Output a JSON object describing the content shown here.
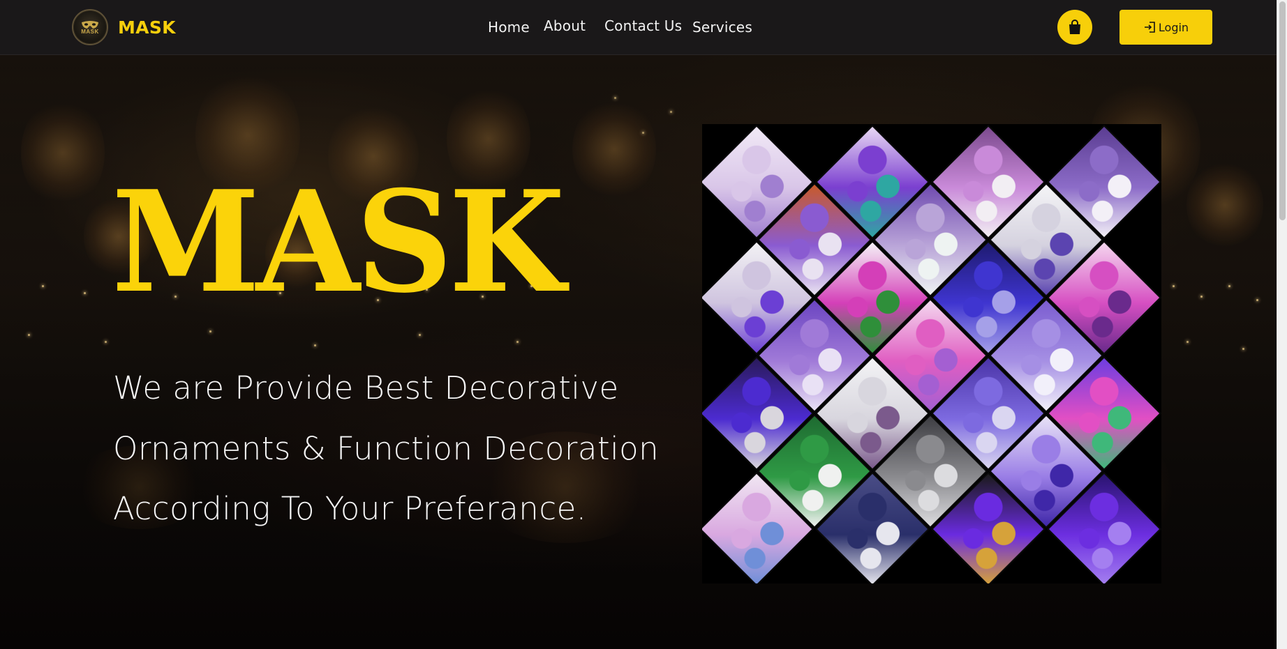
{
  "brand": {
    "name": "MASK",
    "logo_text": "MASK",
    "accent_color": "#f7cf0a"
  },
  "nav": {
    "home": "Home",
    "about": "About",
    "contact": "Contact Us",
    "services": "Services"
  },
  "actions": {
    "cart_icon": "shopping-bag-icon",
    "login_icon": "login-arrow-icon",
    "login_label": "Login"
  },
  "hero": {
    "title": "MASK",
    "lines": [
      "We are Provide Best Decorative",
      "Ornaments & Function Decoration",
      "According To Your Preferance."
    ],
    "background": "event-venue-photo"
  },
  "collage": {
    "image": "decoration-collage",
    "tiles": [
      {
        "name": "lavender-paper-flowers",
        "colors": [
          "#d9c6e8",
          "#a07fd0",
          "#f1e9f6"
        ]
      },
      {
        "name": "flower-vase-teal",
        "colors": [
          "#7b3fd0",
          "#2ea7a2",
          "#e8d8f4"
        ]
      },
      {
        "name": "pink-drape-backdrop",
        "colors": [
          "#c98ad9",
          "#f2eef3",
          "#7c4a8e"
        ]
      },
      {
        "name": "purple-flower-sign",
        "colors": [
          "#8c6cc8",
          "#f3f0f7",
          "#5b3d92"
        ]
      },
      {
        "name": "beaded-pot",
        "colors": [
          "#8a5bd1",
          "#e9e2f1",
          "#c85a2a"
        ]
      },
      {
        "name": "flower-arch-backdrop",
        "colors": [
          "#b9a4d8",
          "#eef3f2",
          "#6f4ab0"
        ]
      },
      {
        "name": "curtain-flowers",
        "colors": [
          "#d5d2df",
          "#5b44b0",
          "#f4f4f6"
        ]
      },
      {
        "name": "purple-curtain",
        "colors": [
          "#cfc4df",
          "#6b3fd4",
          "#f2f1f4"
        ]
      },
      {
        "name": "flower-mirror-frame",
        "colors": [
          "#d43fb8",
          "#2f8f3a",
          "#f5f2f7"
        ]
      },
      {
        "name": "blue-flower-wall",
        "colors": [
          "#3f35d0",
          "#a5a0e8",
          "#1e1a70"
        ]
      },
      {
        "name": "pink-rolled-flowers",
        "colors": [
          "#d64fc2",
          "#6a2a8c",
          "#f5d6ef"
        ]
      },
      {
        "name": "purple-pompoms",
        "colors": [
          "#a07ad8",
          "#e9e1f5",
          "#6b45c1"
        ]
      },
      {
        "name": "paper-ganesha",
        "colors": [
          "#e05ec2",
          "#a45fd2",
          "#f4d8ef"
        ]
      },
      {
        "name": "lilac-stage-decor",
        "colors": [
          "#a58fe4",
          "#f2f0fa",
          "#7b5dd0"
        ]
      },
      {
        "name": "blue-flower-vase",
        "colors": [
          "#4c2bd0",
          "#d9d6dd",
          "#2a1a5c"
        ]
      },
      {
        "name": "tree-of-life-art",
        "colors": [
          "#d8d6de",
          "#7b5a8c",
          "#f3f3f5"
        ]
      },
      {
        "name": "purple-flower-stage",
        "colors": [
          "#7d6ae0",
          "#dad6f1",
          "#4b35a8"
        ]
      },
      {
        "name": "rainbow-paper-fan",
        "colors": [
          "#e24fc4",
          "#3fb87a",
          "#6d3de0"
        ]
      },
      {
        "name": "green-wreath",
        "colors": [
          "#2f9a45",
          "#f0f1f0",
          "#1e6b31"
        ]
      },
      {
        "name": "grey-paper-fan",
        "colors": [
          "#8a8a8e",
          "#dcdcdf",
          "#3d3d42"
        ]
      },
      {
        "name": "purple-roses-wall",
        "colors": [
          "#9a7ee6",
          "#3f27a8",
          "#e8e2f6"
        ]
      },
      {
        "name": "mixed-flower-bouquet",
        "colors": [
          "#d9a8e0",
          "#6f8fd8",
          "#f0e6f2"
        ]
      },
      {
        "name": "navy-paper-flowers",
        "colors": [
          "#2a2f6a",
          "#e6e6ee",
          "#4a4d86"
        ]
      },
      {
        "name": "purple-gold-flowers",
        "colors": [
          "#6a2be0",
          "#d6a23a",
          "#1a1a1a"
        ]
      },
      {
        "name": "purple-roses-bunch",
        "colors": [
          "#6c2ee0",
          "#a47ff0",
          "#2a1470"
        ]
      }
    ]
  }
}
